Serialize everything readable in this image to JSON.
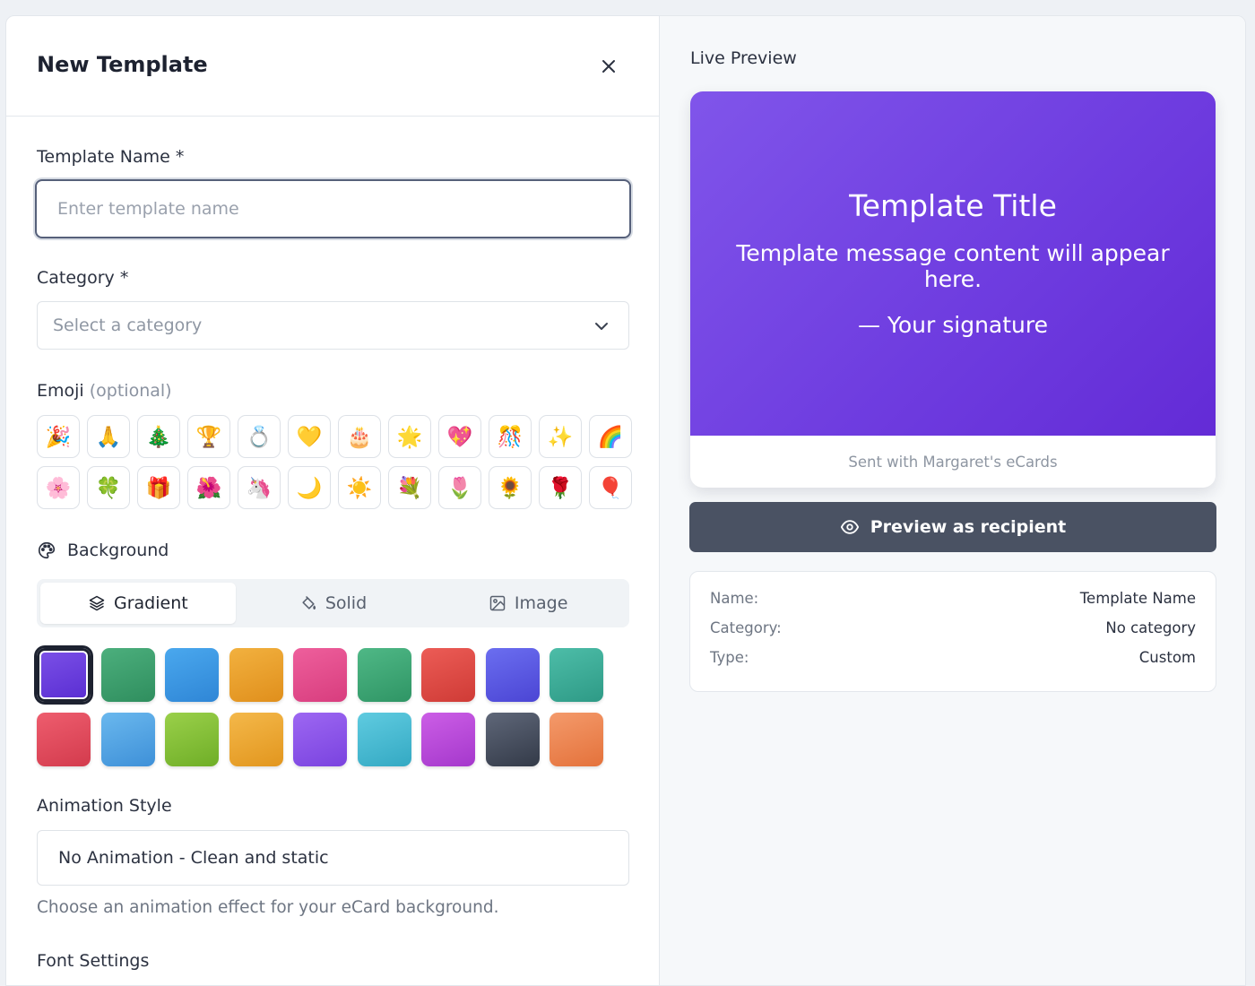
{
  "modal": {
    "title": "New Template"
  },
  "form": {
    "template_name": {
      "label": "Template Name *",
      "placeholder": "Enter template name",
      "value": ""
    },
    "category": {
      "label": "Category *",
      "placeholder": "Select a category"
    },
    "emoji": {
      "label": "Emoji",
      "optional": "(optional)",
      "options": [
        "🎉",
        "🙏",
        "🎄",
        "🏆",
        "💍",
        "💛",
        "🎂",
        "🌟",
        "💖",
        "🎊",
        "✨",
        "🌈",
        "🌸",
        "🍀",
        "🎁",
        "🌺",
        "🦄",
        "🌙",
        "☀️",
        "💐",
        "🌷",
        "🌻",
        "🌹",
        "🎈"
      ]
    },
    "background": {
      "label": "Background",
      "tabs": [
        {
          "label": "Gradient",
          "icon": "layers-icon",
          "active": true
        },
        {
          "label": "Solid",
          "icon": "paint-bucket-icon",
          "active": false
        },
        {
          "label": "Image",
          "icon": "image-icon",
          "active": false
        }
      ],
      "swatches": [
        [
          "#7a4fe6",
          "#5b2fd3"
        ],
        [
          "#4caf7d",
          "#2f8e5e"
        ],
        [
          "#4aa8ee",
          "#2f86d6"
        ],
        [
          "#f2b13f",
          "#e08f1c"
        ],
        [
          "#ee5f9c",
          "#d83d7e"
        ],
        [
          "#4fb886",
          "#2f9565"
        ],
        [
          "#ec5c56",
          "#cf3b36"
        ],
        [
          "#6b6ef0",
          "#4b45d4"
        ],
        [
          "#4dbda8",
          "#2e9a86"
        ],
        [
          "#ee5d6e",
          "#d33b4d"
        ],
        [
          "#6ab8ee",
          "#3e90d8"
        ],
        [
          "#9ad04a",
          "#6fae27"
        ],
        [
          "#f4b84a",
          "#e2961e"
        ],
        [
          "#9d67f2",
          "#7a43df"
        ],
        [
          "#5fcbe0",
          "#34a9c3"
        ],
        [
          "#cc5ee6",
          "#a538cc"
        ],
        [
          "#5f6779",
          "#333a48"
        ],
        [
          "#f49a6b",
          "#e4723b"
        ]
      ],
      "selected_index": 0
    },
    "animation": {
      "label": "Animation Style",
      "value": "No Animation - Clean and static",
      "help": "Choose an animation effect for your eCard background."
    },
    "font_settings": {
      "label": "Font Settings"
    }
  },
  "preview": {
    "heading": "Live Preview",
    "card": {
      "title": "Template Title",
      "message": "Template message content will appear here.",
      "signature": "— Your signature",
      "footer": "Sent with Margaret's eCards"
    },
    "preview_button": "Preview as recipient",
    "summary": [
      {
        "key": "Name:",
        "value": "Template Name"
      },
      {
        "key": "Category:",
        "value": "No category"
      },
      {
        "key": "Type:",
        "value": "Custom"
      }
    ]
  },
  "colors": {
    "accent": "#7a4fe6",
    "button_dark": "#4a5263"
  }
}
